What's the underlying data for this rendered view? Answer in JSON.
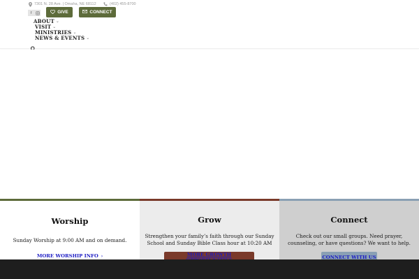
{
  "topbar": {
    "address": "7301 N. 28 Ave. | Omaha, NE 68112",
    "phone": "(402) 455-8700",
    "social": {
      "facebook": "f",
      "instagram": "ig"
    },
    "give_label": "GIVE",
    "connect_label": "CONNECT"
  },
  "nav": {
    "items": [
      {
        "label": "ABOUT"
      },
      {
        "label": "VISIT"
      },
      {
        "label": "MINISTRIES"
      },
      {
        "label": "NEWS & EVENTS"
      }
    ],
    "chevron": "⌄"
  },
  "cards": {
    "worship": {
      "title": "Worship",
      "text": "Sunday Worship at 9:00 AM and on demand.",
      "link": "MORE WORSHIP INFO",
      "arrow": "›"
    },
    "grow": {
      "title": "Grow",
      "text": "Strengthen your family’s faith through our Sunday School and Sunday Bible Class hour at 10:20 AM",
      "button": "MORE GROWTH OPPORTUNITIES"
    },
    "connect": {
      "title": "Connect",
      "text": "Check out our small groups. Need prayer, counseling, or have questions? We want to help.",
      "button": "CONNECT WITH US"
    }
  },
  "colors": {
    "olive": "#5d6b3a",
    "rust": "#7a3a2a",
    "steel_blue": "#8aa0b4",
    "link_blue": "#1b1bc4",
    "footer": "#1e1e1e"
  },
  "icons": [
    "location-icon",
    "phone-icon",
    "heart-icon",
    "envelope-icon",
    "search-icon",
    "chevron-down-icon"
  ]
}
